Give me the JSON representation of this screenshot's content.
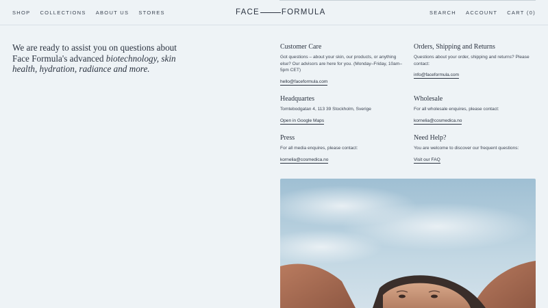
{
  "nav": {
    "left": [
      "SHOP",
      "COLLECTIONS",
      "ABOUT US",
      "STORES"
    ],
    "right": [
      "SEARCH",
      "ACCOUNT",
      "CART (0)"
    ],
    "logo_left": "FACE",
    "logo_right": "FORMULA"
  },
  "intro": {
    "lead": "We are ready to assist you on questions about Face Formula's advanced ",
    "emphasis": "biotechnology, skin health, hydration, radiance and more."
  },
  "contacts": [
    {
      "title": "Customer Care",
      "text": "Got questions – about your skin, our products, or anything else? Our advisors are here for you. (Monday–Friday, 10am–5pm CET)",
      "link": "hello@faceformula.com"
    },
    {
      "title": "Orders, Shipping and Returns",
      "text": "Questions about your order, shipping and returns? Please contact:",
      "link": "info@faceformula.com"
    },
    {
      "title": "Headquartes",
      "text": "Tomtebodgatan 4, 113 39 Stockholm, Sverige",
      "link": "Open in Google Maps"
    },
    {
      "title": "Wholesale",
      "text": "For all wholesale enquires, please contact:",
      "link": "kornelia@cosmedica.no"
    },
    {
      "title": "Press",
      "text": "For all media enquires, please contact:",
      "link": "kornelia@cosmedica.no"
    },
    {
      "title": "Need Help?",
      "text": "You are welcome to discover our frequent questions:",
      "link": "Visit our FAQ"
    }
  ],
  "colors": {
    "background": "#eef3f6",
    "text": "#2b3340",
    "sky": "#a9c6d8",
    "skin": "#a86c52"
  }
}
